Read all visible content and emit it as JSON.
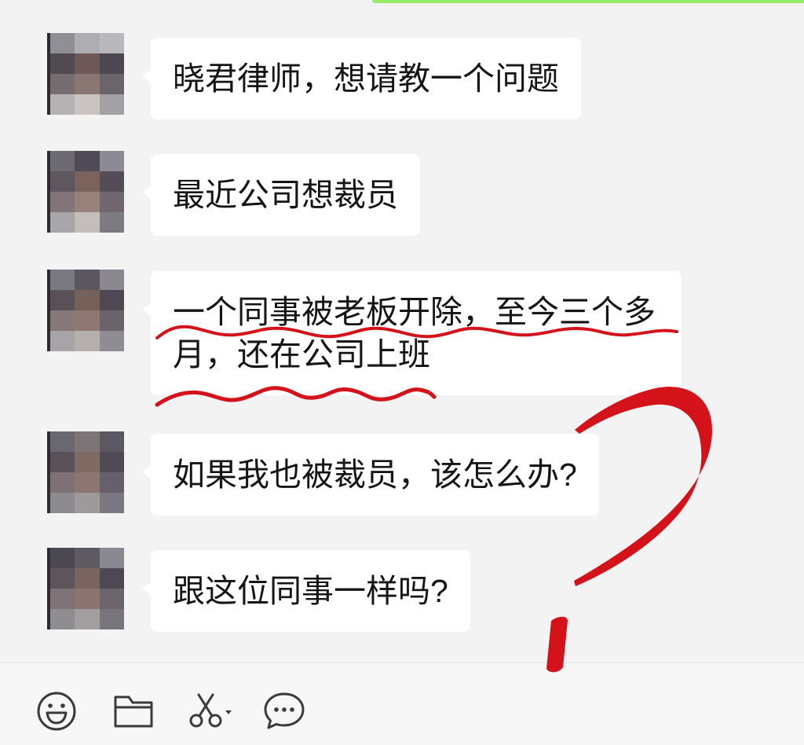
{
  "messages": [
    {
      "text": "晓君律师，想请教一个问题"
    },
    {
      "text": "最近公司想裁员"
    },
    {
      "text": "一个同事被老板开除，至今三个多月，还在公司上班"
    },
    {
      "text": "如果我也被裁员，该怎么办?"
    },
    {
      "text": "跟这位同事一样吗?"
    }
  ],
  "toolbar": {
    "icons": [
      "emoji-icon",
      "folder-icon",
      "screenshot-scissors-icon",
      "chat-history-icon"
    ]
  },
  "colors": {
    "self_bubble": "#95ec69",
    "annotation": "#d3121a"
  }
}
